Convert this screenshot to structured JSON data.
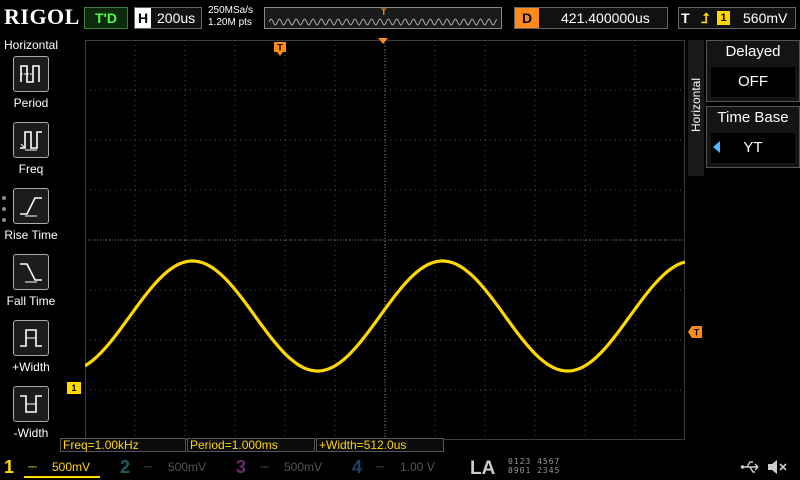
{
  "topbar": {
    "logo": "RIGOL",
    "trigger_status": "T'D",
    "horizontal_label": "H",
    "timebase": "200us",
    "sample_rate": "250MSa/s",
    "memory_depth": "1.20M pts",
    "delay_label": "D",
    "delay_value": "421.400000us",
    "trigger_label": "T",
    "trigger_source": "1",
    "trigger_level": "560mV"
  },
  "left_menu": {
    "title": "Horizontal",
    "items": [
      {
        "label": "Period",
        "icon": "period-icon"
      },
      {
        "label": "Freq",
        "icon": "freq-icon"
      },
      {
        "label": "Rise Time",
        "icon": "rise-time-icon"
      },
      {
        "label": "Fall Time",
        "icon": "fall-time-icon"
      },
      {
        "label": "+Width",
        "icon": "positive-width-icon"
      },
      {
        "label": "-Width",
        "icon": "negative-width-icon"
      }
    ]
  },
  "right_menu": {
    "tab_label": "Horizontal",
    "delayed": {
      "label": "Delayed",
      "value": "OFF"
    },
    "time_base": {
      "label": "Time Base",
      "value": "YT"
    }
  },
  "waveform": {
    "channel_marker": "1",
    "trigger_marker": "T",
    "color": "#ffd800",
    "cycles_shown": 2.4
  },
  "measurements": [
    "Freq=1.00kHz",
    "Period=1.000ms",
    "+Width=512.0us"
  ],
  "channels": [
    {
      "number": "1",
      "value": "500mV",
      "color": "#ffd800",
      "active": true
    },
    {
      "number": "2",
      "value": "500mV",
      "color": "#1a5b5b",
      "active": false
    },
    {
      "number": "3",
      "value": "500mV",
      "color": "#6b2a6b",
      "active": false
    },
    {
      "number": "4",
      "value": "1.00 V",
      "color": "#1f3f6b",
      "active": false
    }
  ],
  "logic_analyzer": {
    "label": "LA",
    "row1": "0123 4567",
    "row2": "8901 2345"
  }
}
